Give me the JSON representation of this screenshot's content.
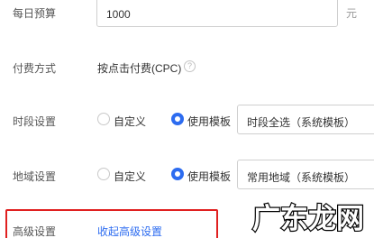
{
  "budget": {
    "label": "每日预算",
    "value": "1000",
    "unit": "元"
  },
  "payment": {
    "label": "付费方式",
    "value": "按点击付费(CPC)",
    "help_icon": "question-circle-icon"
  },
  "time_setting": {
    "label": "时段设置",
    "options": [
      "自定义",
      "使用模板"
    ],
    "selected": "使用模板",
    "template_value": "时段全选（系统模板）"
  },
  "region_setting": {
    "label": "地域设置",
    "options": [
      "自定义",
      "使用模板"
    ],
    "selected": "使用模板",
    "template_value": "常用地域（系统模板）"
  },
  "advanced": {
    "label": "高级设置",
    "link": "收起高级设置"
  },
  "watermark": {
    "text": "广东龙网"
  },
  "colors": {
    "accent": "#2d6cf0",
    "highlight_border": "#e02020"
  }
}
